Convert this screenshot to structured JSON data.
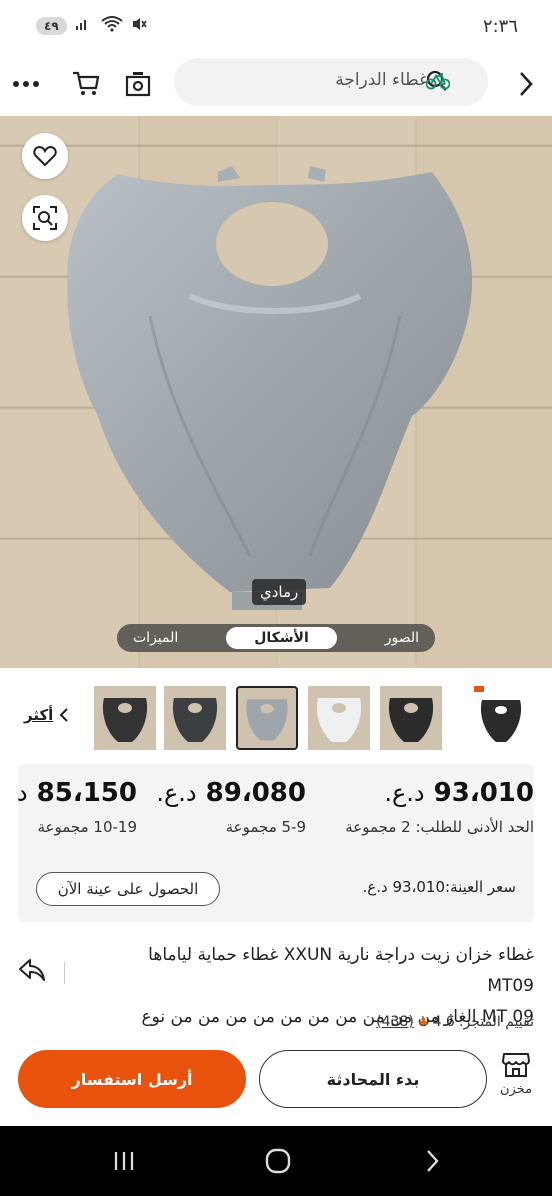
{
  "status": {
    "time": "٢:٣٦",
    "battery": "٤٩"
  },
  "nav": {
    "search_text": "غطاء الدراجة",
    "icons": [
      "back-arrow-icon",
      "search-icon",
      "bike-icon",
      "camera-icon",
      "cart-icon",
      "more-icon"
    ]
  },
  "gallery": {
    "color_tag": "رمادي",
    "tabs": [
      "الصور",
      "الأشكال",
      "الميزات"
    ],
    "active_tab": "الأشكال",
    "more_label": "أكثر",
    "thumbnail_count": 6,
    "selected_thumbnail": 3
  },
  "pricing": {
    "tiers": [
      {
        "price": "93،010",
        "currency": "د.ع.",
        "qty": "الحد الأدنى للطلب: 2 مجموعة"
      },
      {
        "price": "89،080",
        "currency": "د.ع.",
        "qty": "5-9 مجموعة"
      },
      {
        "price": "85،150",
        "currency": "د.ع.",
        "qty": "10-19 مجموعة"
      }
    ],
    "sample_price": "سعر العينة:93،010 د.ع.",
    "sample_button": "الحصول على عينة الآن"
  },
  "product": {
    "title_line1": "غطاء خزان زيت دراجة نارية XXUN غطاء حماية لياماها MT09",
    "title_line2": "MT 09 الغاز من من من من من من من من من من نوع XXUN",
    "rating_label": "تقييم المتجر:",
    "rating_value": "4.6",
    "rating_count": "(438)"
  },
  "actions": {
    "store_label": "مخزن",
    "chat_label": "بدء المحادثة",
    "inquiry_label": "أرسل استفسار"
  },
  "colors": {
    "accent": "#e8520c",
    "product_gray": "#9ea5ab"
  }
}
